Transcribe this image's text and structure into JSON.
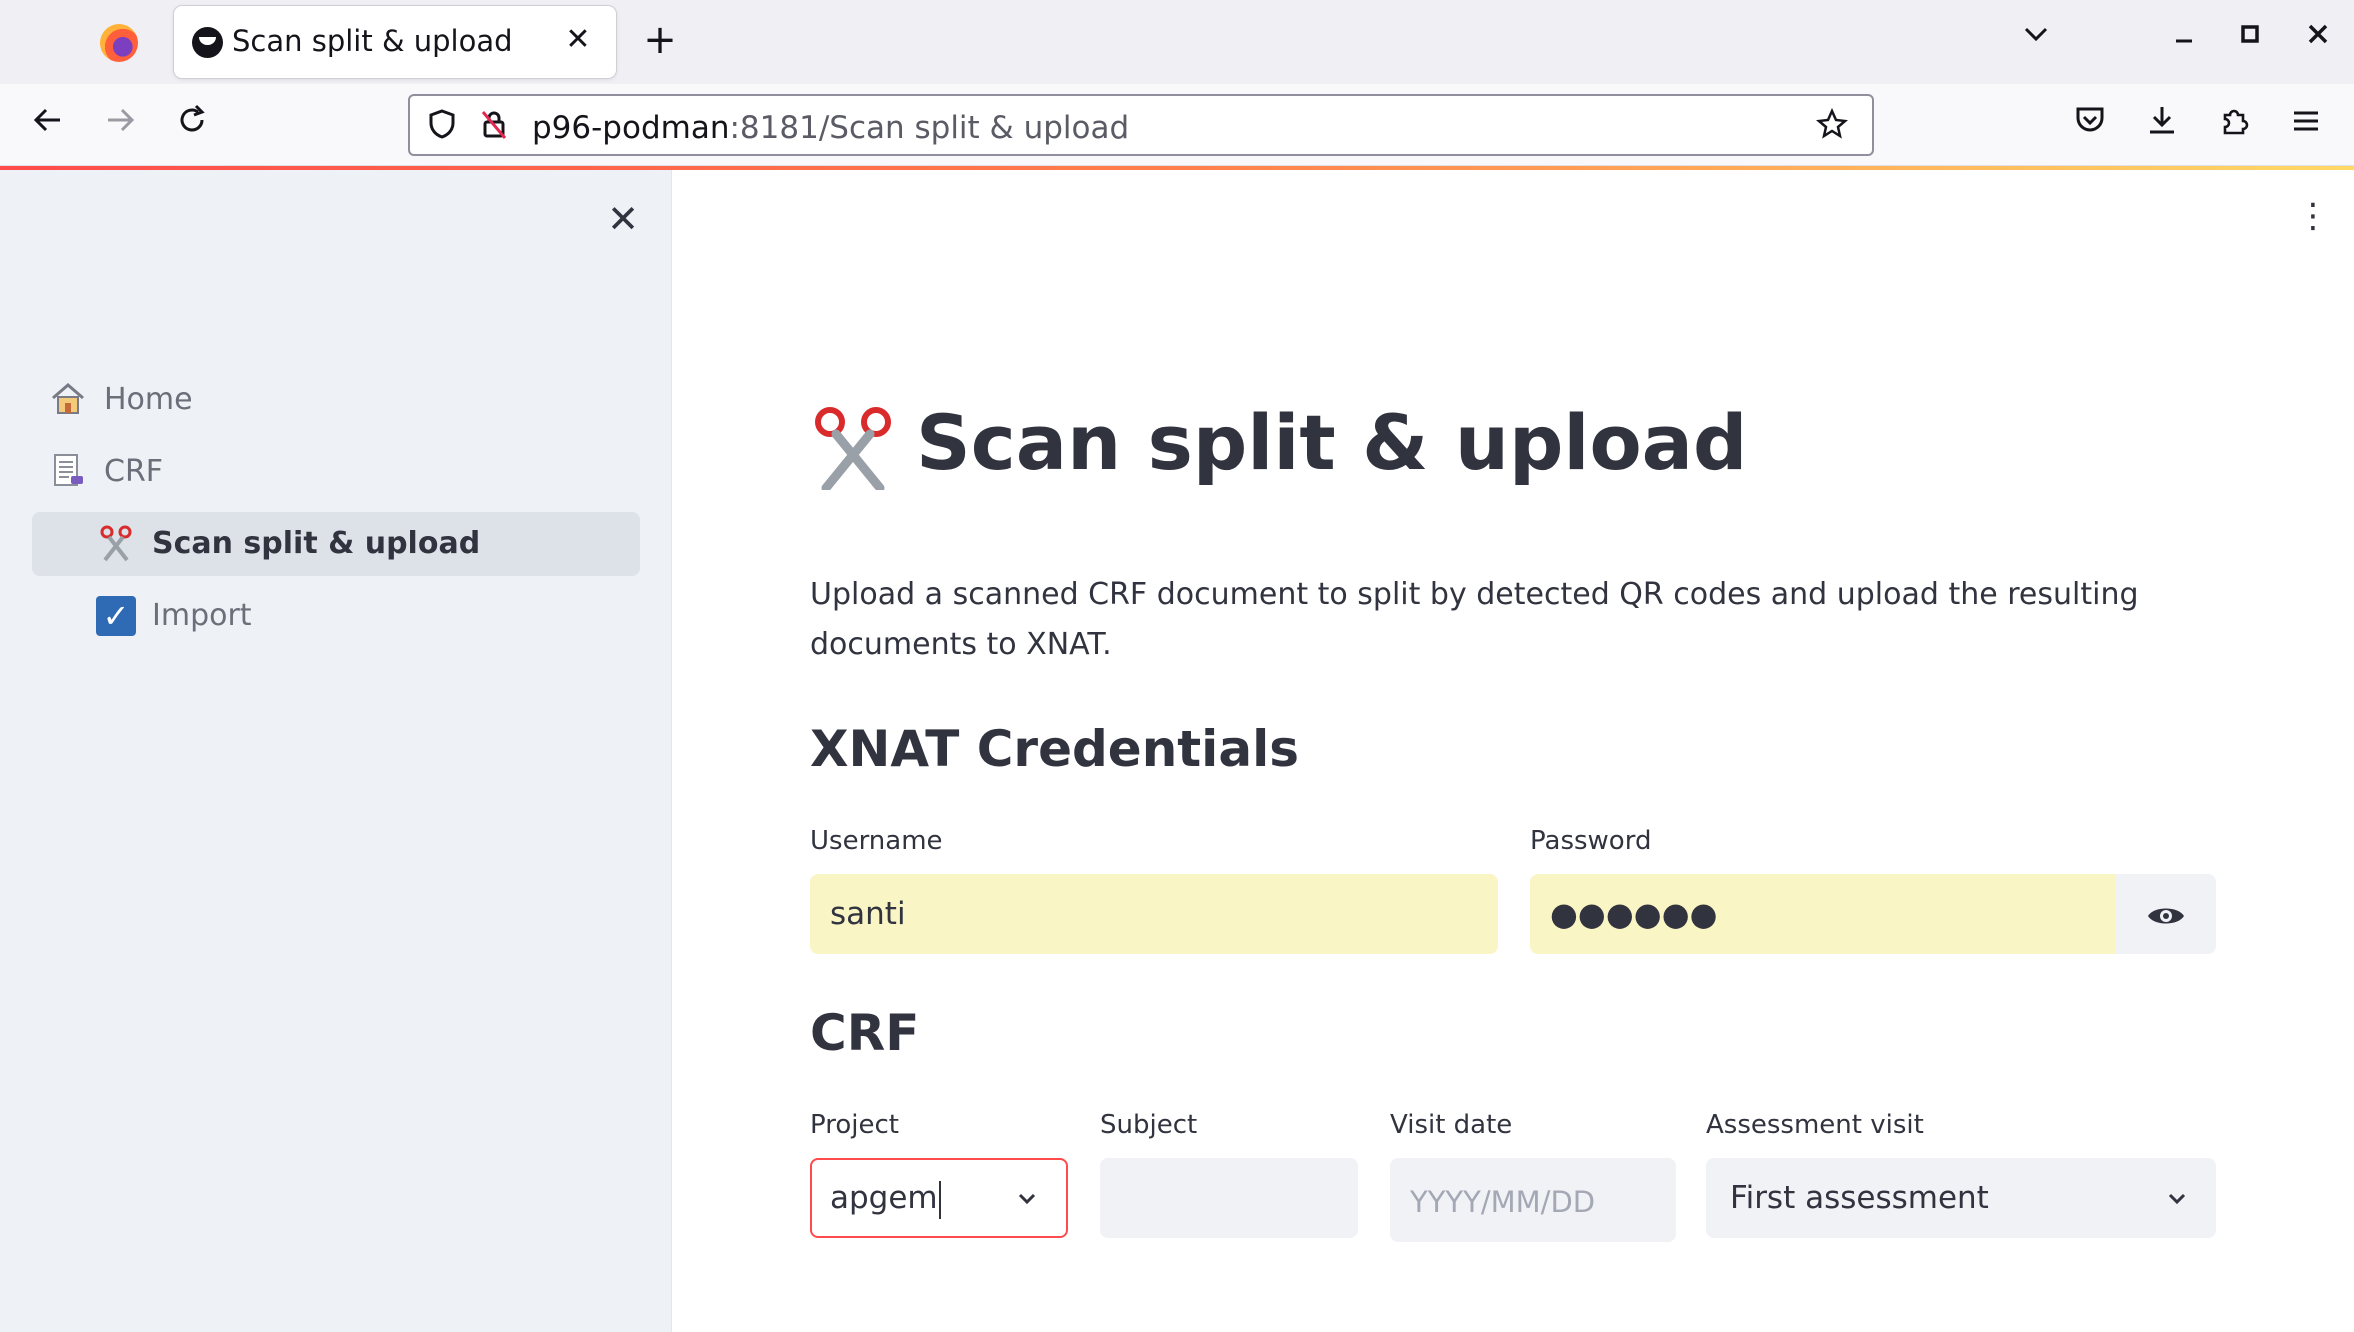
{
  "browser": {
    "tab_title": "Scan split & upload",
    "tab_close": "✕",
    "new_tab": "+",
    "url_host": "p96-podman",
    "url_rest": ":8181/Scan split & upload",
    "controls": {
      "list_all_tabs": "⌄",
      "minimize": "–",
      "maximize": "□",
      "close": "✕"
    }
  },
  "sidebar": {
    "close_label": "✕",
    "items": [
      {
        "label": "Home",
        "icon": "house-icon"
      },
      {
        "label": "CRF",
        "icon": "document-icon"
      },
      {
        "label": "Scan split & upload",
        "icon": "scissors-icon",
        "active": true
      },
      {
        "label": "Import",
        "icon": "checkbox-icon"
      }
    ]
  },
  "main": {
    "menu": "⋮",
    "title": "Scan split & upload",
    "intro": "Upload a scanned CRF document to split by detected QR codes and upload the resulting documents to XNAT.",
    "credentials": {
      "heading": "XNAT Credentials",
      "username_label": "Username",
      "username_value": "santi",
      "password_label": "Password",
      "password_value": "●●●●●●"
    },
    "crf": {
      "heading": "CRF",
      "project_label": "Project",
      "project_value": "apgem",
      "subject_label": "Subject",
      "subject_value": "",
      "visit_date_label": "Visit date",
      "visit_date_placeholder": "YYYY/MM/DD",
      "assessment_label": "Assessment visit",
      "assessment_value": "First assessment"
    }
  },
  "colors": {
    "accent": "#ff4b4b",
    "sidebar_bg": "#eef1f5",
    "input_bg": "#f0f2f6",
    "autofill_bg": "#faf5c5",
    "text": "#31333f"
  }
}
